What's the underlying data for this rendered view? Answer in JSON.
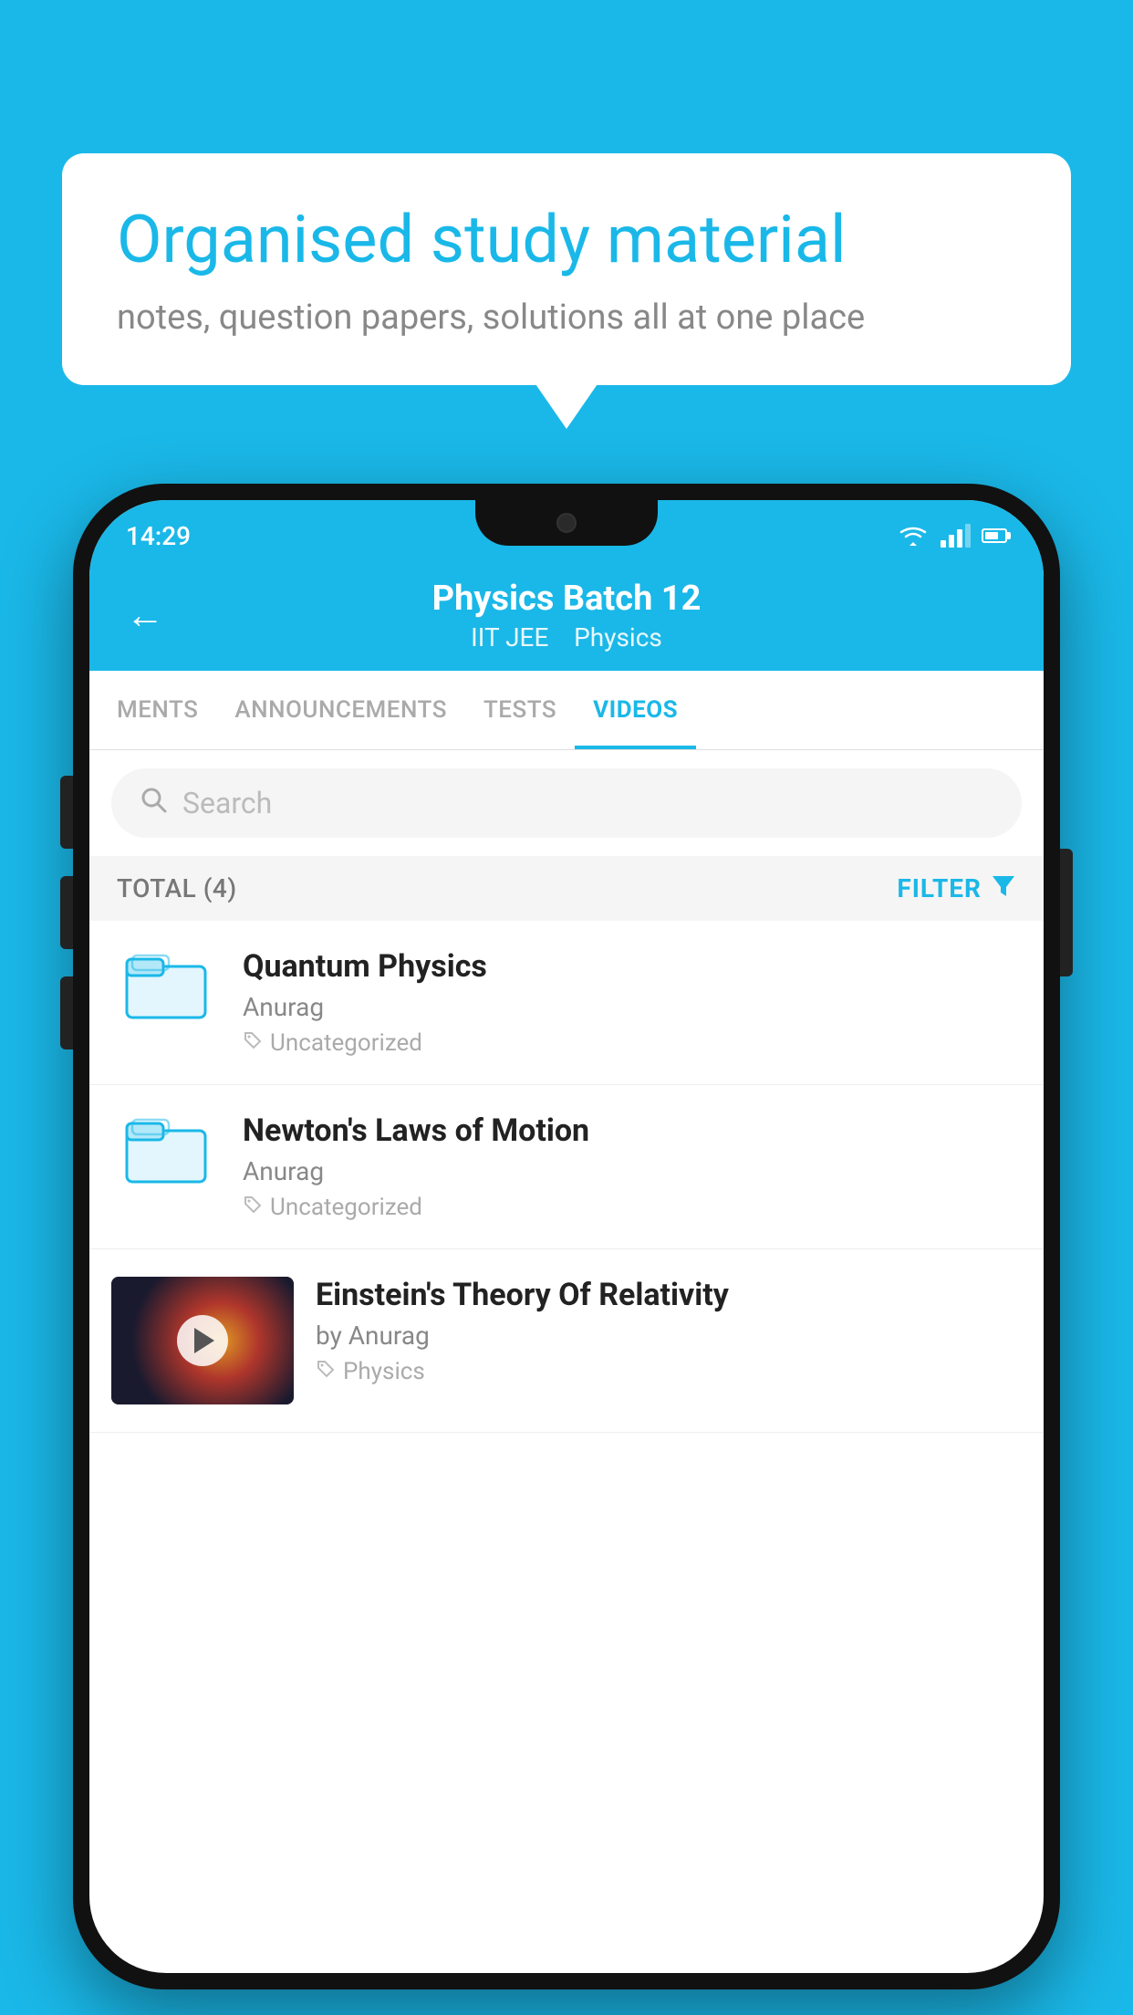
{
  "bubble": {
    "title": "Organised study material",
    "subtitle": "notes, question papers, solutions all at one place"
  },
  "status_bar": {
    "time": "14:29"
  },
  "header": {
    "title": "Physics Batch 12",
    "subtitle_part1": "IIT JEE",
    "subtitle_part2": "Physics",
    "back_label": "←"
  },
  "tabs": [
    {
      "label": "MENTS",
      "active": false
    },
    {
      "label": "ANNOUNCEMENTS",
      "active": false
    },
    {
      "label": "TESTS",
      "active": false
    },
    {
      "label": "VIDEOS",
      "active": true
    }
  ],
  "search": {
    "placeholder": "Search"
  },
  "filter": {
    "total_label": "TOTAL (4)",
    "filter_label": "FILTER"
  },
  "videos": [
    {
      "title": "Quantum Physics",
      "author": "Anurag",
      "tag": "Uncategorized",
      "type": "folder",
      "has_thumb": false
    },
    {
      "title": "Newton's Laws of Motion",
      "author": "Anurag",
      "tag": "Uncategorized",
      "type": "folder",
      "has_thumb": false
    },
    {
      "title": "Einstein's Theory Of Relativity",
      "author": "by Anurag",
      "tag": "Physics",
      "type": "video",
      "has_thumb": true
    }
  ]
}
